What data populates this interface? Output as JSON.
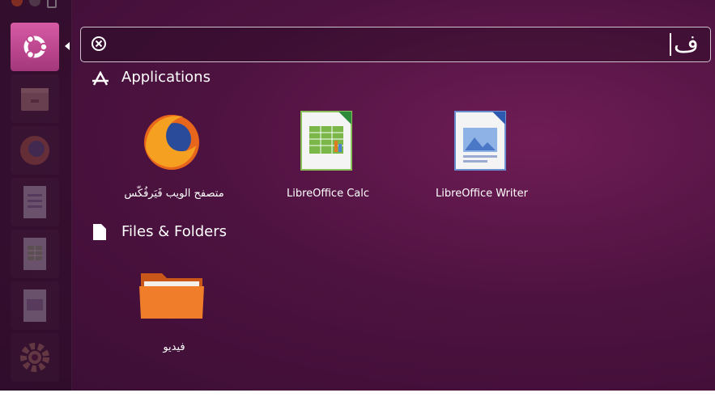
{
  "search": {
    "value": "ف",
    "clear_icon": "clear-circle-x-icon"
  },
  "sections": {
    "applications": {
      "title": "Applications",
      "icon": "applications-icon",
      "items": [
        {
          "label": "متصفح الويب فَيَرفُكّس",
          "icon": "firefox-icon"
        },
        {
          "label": "LibreOffice Calc",
          "icon": "libreoffice-calc-icon"
        },
        {
          "label": "LibreOffice Writer",
          "icon": "libreoffice-writer-icon"
        }
      ]
    },
    "files": {
      "title": "Files & Folders",
      "icon": "file-icon",
      "items": [
        {
          "label": "فيديو",
          "icon": "folder-icon"
        }
      ]
    }
  },
  "launcher": {
    "items": [
      "ubuntu-dash-icon",
      "file-manager-icon",
      "firefox-icon",
      "libreoffice-writer-icon",
      "libreoffice-calc-icon",
      "libreoffice-impress-icon",
      "settings-gear-icon"
    ]
  },
  "colors": {
    "background": "#4d1240",
    "dash_button": "#c1468d"
  }
}
